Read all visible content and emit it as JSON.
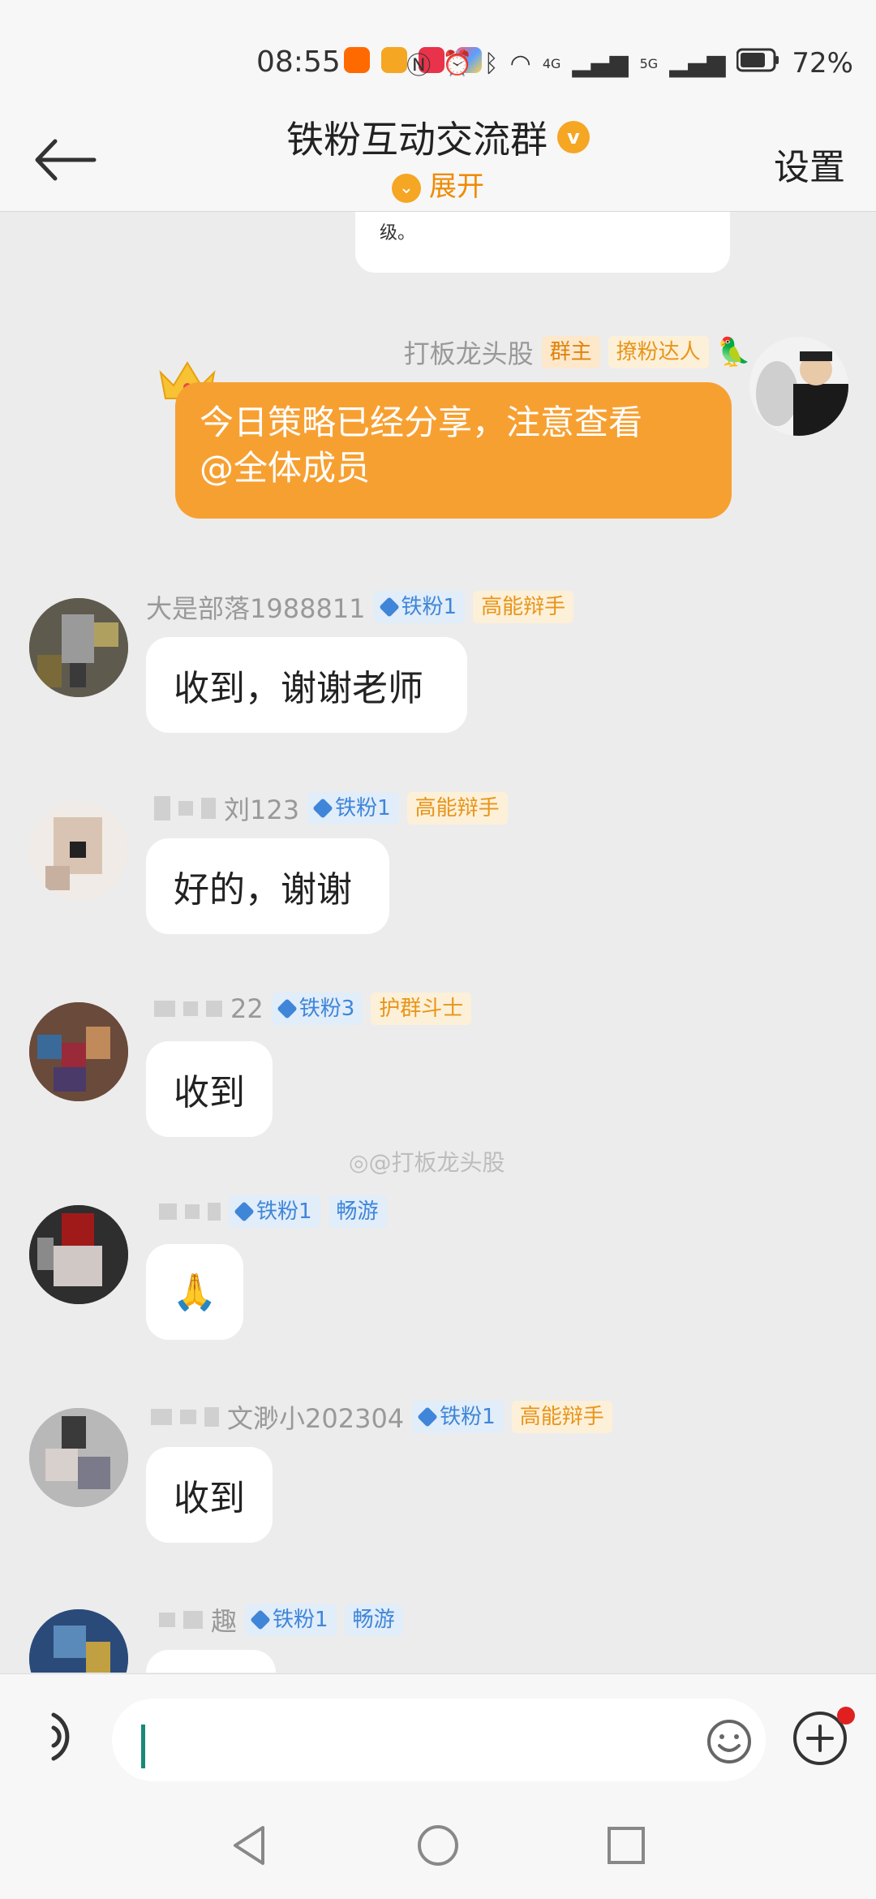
{
  "status_bar": {
    "time": "08:55",
    "network_4g": "4G",
    "network_5g": "5G",
    "battery": "72%"
  },
  "header": {
    "title": "铁粉互动交流群",
    "expand_label": "展开",
    "settings_label": "设置"
  },
  "previous_message_tail": "级。",
  "messages": [
    {
      "sender": "打板龙头股",
      "badges": [
        "群主",
        "撩粉达人"
      ],
      "text": "今日策略已经分享，注意查看@全体成员",
      "text_line1": "今日策略已经分享，注意查看",
      "text_line2": "@全体成员"
    },
    {
      "sender": "大是部落1988811",
      "fan_level": "铁粉1",
      "title_badge": "高能辩手",
      "text": "收到，谢谢老师"
    },
    {
      "sender": "刘123",
      "fan_level": "铁粉1",
      "title_badge": "高能辩手",
      "text": "好的，谢谢"
    },
    {
      "sender": "22",
      "fan_level": "铁粉3",
      "title_badge": "护群斗士",
      "text": "收到"
    },
    {
      "sender": "",
      "fan_level": "铁粉1",
      "title_badge": "畅游",
      "text": "🙏"
    },
    {
      "sender": "文渺小202304",
      "fan_level": "铁粉1",
      "title_badge": "高能辩手",
      "text": "收到"
    },
    {
      "sender": "趣",
      "fan_level": "铁粉1",
      "title_badge": "畅游",
      "text": ""
    }
  ],
  "watermark": "@打板龙头股",
  "input": {
    "value": "",
    "placeholder": ""
  },
  "colors": {
    "accent": "#f7a032",
    "fan_badge_blue": "#3f86d8",
    "title_badge_orange": "#e8951a",
    "background": "#ececec"
  },
  "icons": {
    "back": "arrow-left-icon",
    "voice": "voice-icon",
    "emoji": "emoji-icon",
    "plus": "plus-icon",
    "nav_back": "triangle-back-icon",
    "nav_home": "circle-home-icon",
    "nav_recents": "square-recents-icon"
  }
}
